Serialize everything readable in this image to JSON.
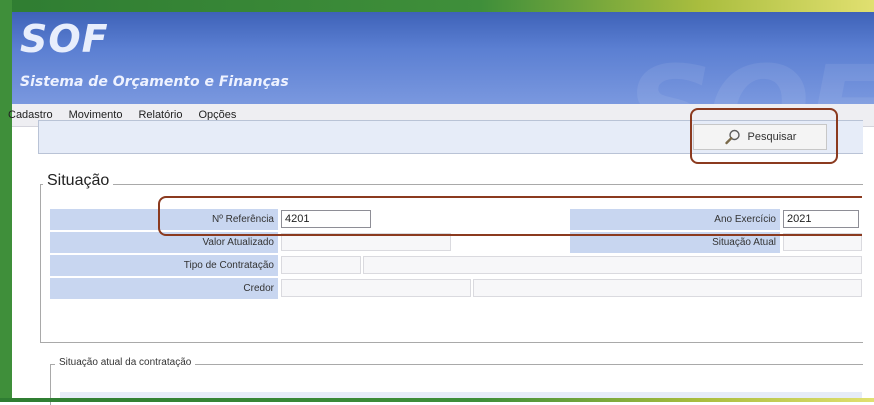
{
  "app": {
    "logo": "SOF",
    "subtitle": "Sistema de Orçamento e Finanças"
  },
  "menu": [
    "Cadastro",
    "Movimento",
    "Relatório",
    "Opções"
  ],
  "toolbar": {
    "search_label": "Pesquisar",
    "search_icon": "magnifier-icon"
  },
  "situacao": {
    "legend": "Situação",
    "fields": {
      "referencia_label": "Nº Referência",
      "referencia_value": "4201",
      "ano_label": "Ano Exercício",
      "ano_value": "2021",
      "valor_label": "Valor Atualizado",
      "situacao_label": "Situação Atual",
      "tipo_label": "Tipo de Contratação",
      "credor_label": "Credor"
    }
  },
  "contratacao": {
    "legend": "Situação atual da contratação"
  },
  "colors": {
    "header": "#4a6ec4",
    "highlight": "#8b3a1f",
    "label_bg": "#c8d6f0"
  }
}
